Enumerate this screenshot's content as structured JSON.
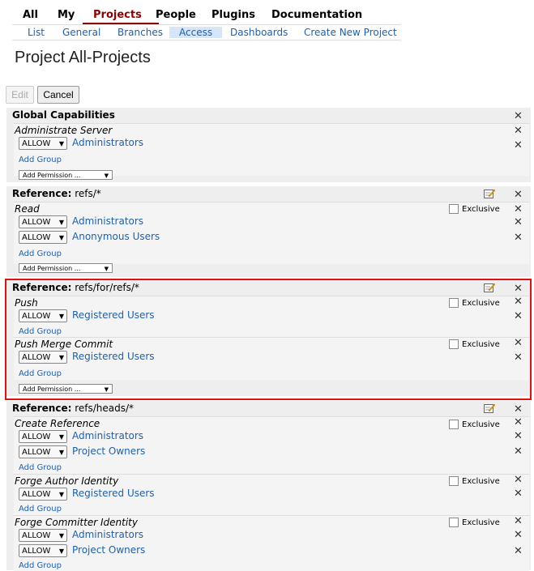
{
  "top_nav": [
    "All",
    "My",
    "Projects",
    "People",
    "Plugins",
    "Documentation"
  ],
  "sub_nav": [
    "List",
    "General",
    "Branches",
    "Access",
    "Dashboards",
    "Create New Project"
  ],
  "page_title": "Project All-Projects",
  "buttons": {
    "edit": "Edit",
    "cancel": "Cancel"
  },
  "labels": {
    "allow": "ALLOW",
    "add_group": "Add Group",
    "add_permission": "Add Permission ...",
    "exclusive": "Exclusive",
    "reference": "Reference:"
  },
  "global_capabilities": {
    "title": "Global Capabilities",
    "permission": "Administrate Server",
    "group": "Administrators"
  },
  "refs_all": {
    "ref": "refs/*",
    "permission": "Read",
    "groups": [
      "Administrators",
      "Anonymous Users"
    ]
  },
  "refs_for": {
    "ref": "refs/for/refs/*",
    "permissions": [
      {
        "name": "Push",
        "group": "Registered Users"
      },
      {
        "name": "Push Merge Commit",
        "group": "Registered Users"
      }
    ]
  },
  "refs_heads": {
    "ref": "refs/heads/*",
    "permissions": [
      {
        "name": "Create Reference",
        "groups": [
          "Administrators",
          "Project Owners"
        ]
      },
      {
        "name": "Forge Author Identity",
        "groups": [
          "Registered Users"
        ]
      },
      {
        "name": "Forge Committer Identity",
        "groups": [
          "Administrators",
          "Project Owners"
        ]
      }
    ]
  },
  "icons": {
    "close": "close-icon",
    "edit": "edit-icon"
  },
  "colors": {
    "link": "#2061a8",
    "active_tab": "#8b0000",
    "highlight": "#e01010"
  }
}
